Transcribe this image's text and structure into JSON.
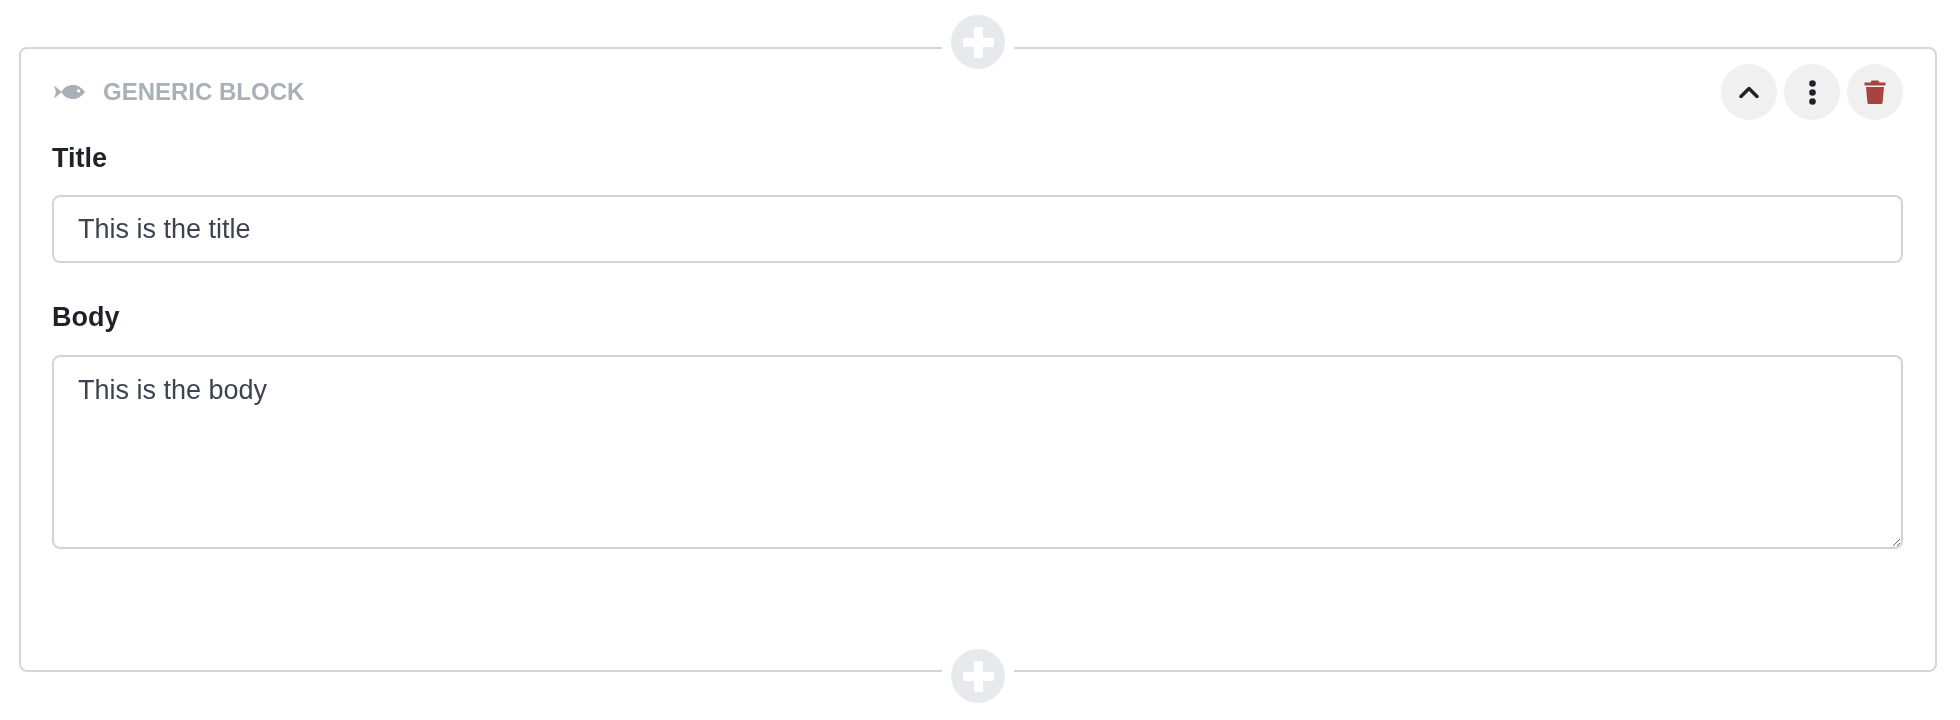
{
  "block": {
    "type_label": "GENERIC BLOCK",
    "actions": [
      {
        "kind": "collapse"
      },
      {
        "kind": "menu"
      },
      {
        "kind": "delete"
      }
    ]
  },
  "fields": [
    {
      "kind": "input",
      "label": "Title",
      "value": "This is the title"
    },
    {
      "kind": "textarea",
      "label": "Body",
      "value": "This is the body"
    }
  ]
}
